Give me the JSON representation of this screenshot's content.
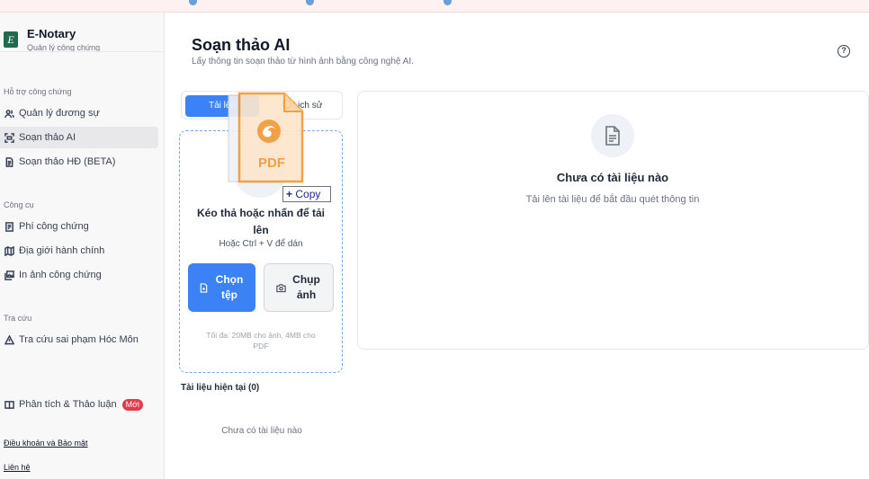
{
  "brand": {
    "logo_letter": "E",
    "name": "E-Notary",
    "subtitle": "Quản lý công chứng"
  },
  "sidebar": {
    "sections": [
      {
        "title": "Hỗ trợ công chứng",
        "items": [
          {
            "label": "Quản lý đương sự",
            "icon": "users-icon"
          },
          {
            "label": "Soạn thảo AI",
            "icon": "scan-icon",
            "active": true
          },
          {
            "label": "Soạn thảo HĐ (BETA)",
            "icon": "document-icon"
          }
        ]
      },
      {
        "title": "Công cụ",
        "items": [
          {
            "label": "Phí công chứng",
            "icon": "receipt-icon"
          },
          {
            "label": "Địa giới hành chính",
            "icon": "map-icon"
          },
          {
            "label": "In ảnh công chứng",
            "icon": "images-icon"
          }
        ]
      },
      {
        "title": "Tra cứu",
        "items": [
          {
            "label": "Tra cứu sai phạm Hóc Môn",
            "icon": "warning-icon"
          }
        ]
      }
    ],
    "discussion": {
      "label": "Phân tích & Thảo luận",
      "badge": "Mới",
      "icon": "book-icon"
    },
    "footer": {
      "terms": "Điều khoản và Bảo mật",
      "contact": "Liên hệ"
    }
  },
  "main": {
    "title": "Soạn thảo AI",
    "subtitle": "Lấy thông tin soạn thảo từ hình ảnh bằng công nghệ AI.",
    "help": "?",
    "tabs": [
      {
        "label": "Tải lên",
        "active": true
      },
      {
        "label": "Lịch sử"
      }
    ],
    "dropzone": {
      "title": "Kéo thả hoặc nhấn để tải lên",
      "hint": "Hoặc Ctrl + V để dán",
      "choose_label": "Chọn tệp",
      "photo_label": "Chụp ảnh",
      "limit": "Tối đa: 20MB cho ảnh, 4MB cho PDF"
    },
    "current_docs": {
      "label": "Tài liệu hiện tại (0)",
      "empty": "Chưa có tài liệu nào"
    },
    "preview": {
      "title": "Chưa có tài liệu nào",
      "subtitle": "Tải lên tài liệu để bắt đầu quét thông tin"
    },
    "drag": {
      "file_type": "PDF",
      "tooltip_plus": "+",
      "tooltip": "Copy"
    }
  },
  "colors": {
    "accent": "#3b82f6",
    "brand": "#1f6b4f",
    "badge": "#e23b4b",
    "pdf": "#f19a38"
  }
}
